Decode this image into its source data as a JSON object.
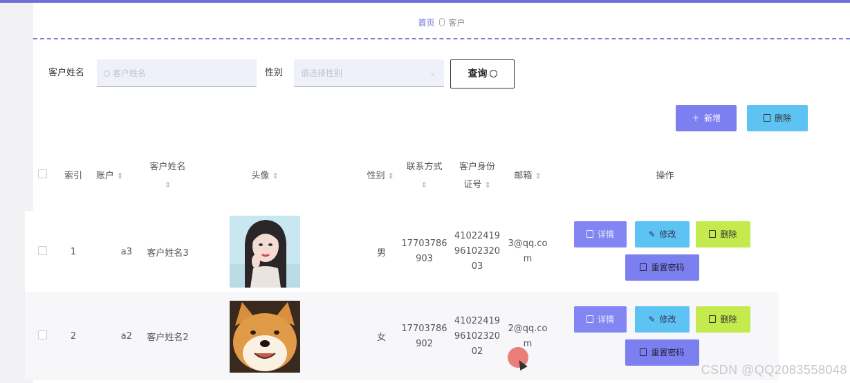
{
  "breadcrumb": {
    "home": "首页",
    "current": "客户"
  },
  "search": {
    "name_label": "客户姓名",
    "name_placeholder": "客户姓名",
    "gender_label": "性别",
    "gender_placeholder": "请选择性别",
    "query_label": "查询"
  },
  "toolbar": {
    "add_label": "新增",
    "delete_label": "删除"
  },
  "table": {
    "headers": {
      "index": "索引",
      "account": "账户",
      "name_line1": "客户姓名",
      "avatar": "头像",
      "gender": "性别",
      "phone_line1": "联系方式",
      "idcard_line1": "客户身份",
      "idcard_line2": "证号",
      "email": "邮箱",
      "actions": "操作",
      "sort_glyph": "⇕"
    },
    "rows": [
      {
        "index": "1",
        "account": "a3",
        "name": "客户姓名3",
        "avatar": "girl-portrait",
        "gender": "男",
        "phone_1": "17703786",
        "phone_2": "903",
        "id_1": "41022419",
        "id_2": "96102320",
        "id_3": "03",
        "email_1": "3@qq.co",
        "email_2": "m"
      },
      {
        "index": "2",
        "account": "a2",
        "name": "客户姓名2",
        "avatar": "shiba-dog",
        "gender": "女",
        "phone_1": "17703786",
        "phone_2": "902",
        "id_1": "41022419",
        "id_2": "96102320",
        "id_3": "02",
        "email_1": "2@qq.co",
        "email_2": "m"
      }
    ],
    "row_actions": {
      "detail": "详情",
      "edit": "修改",
      "delete": "删除",
      "reset_password": "重置密码"
    }
  },
  "watermark": "CSDN @QQ2083558048",
  "colors": {
    "accent": "#6c70d8",
    "purple_button": "#7c7ff0",
    "blue_button": "#5dc3f2",
    "lime_button": "#c5ea4e"
  }
}
